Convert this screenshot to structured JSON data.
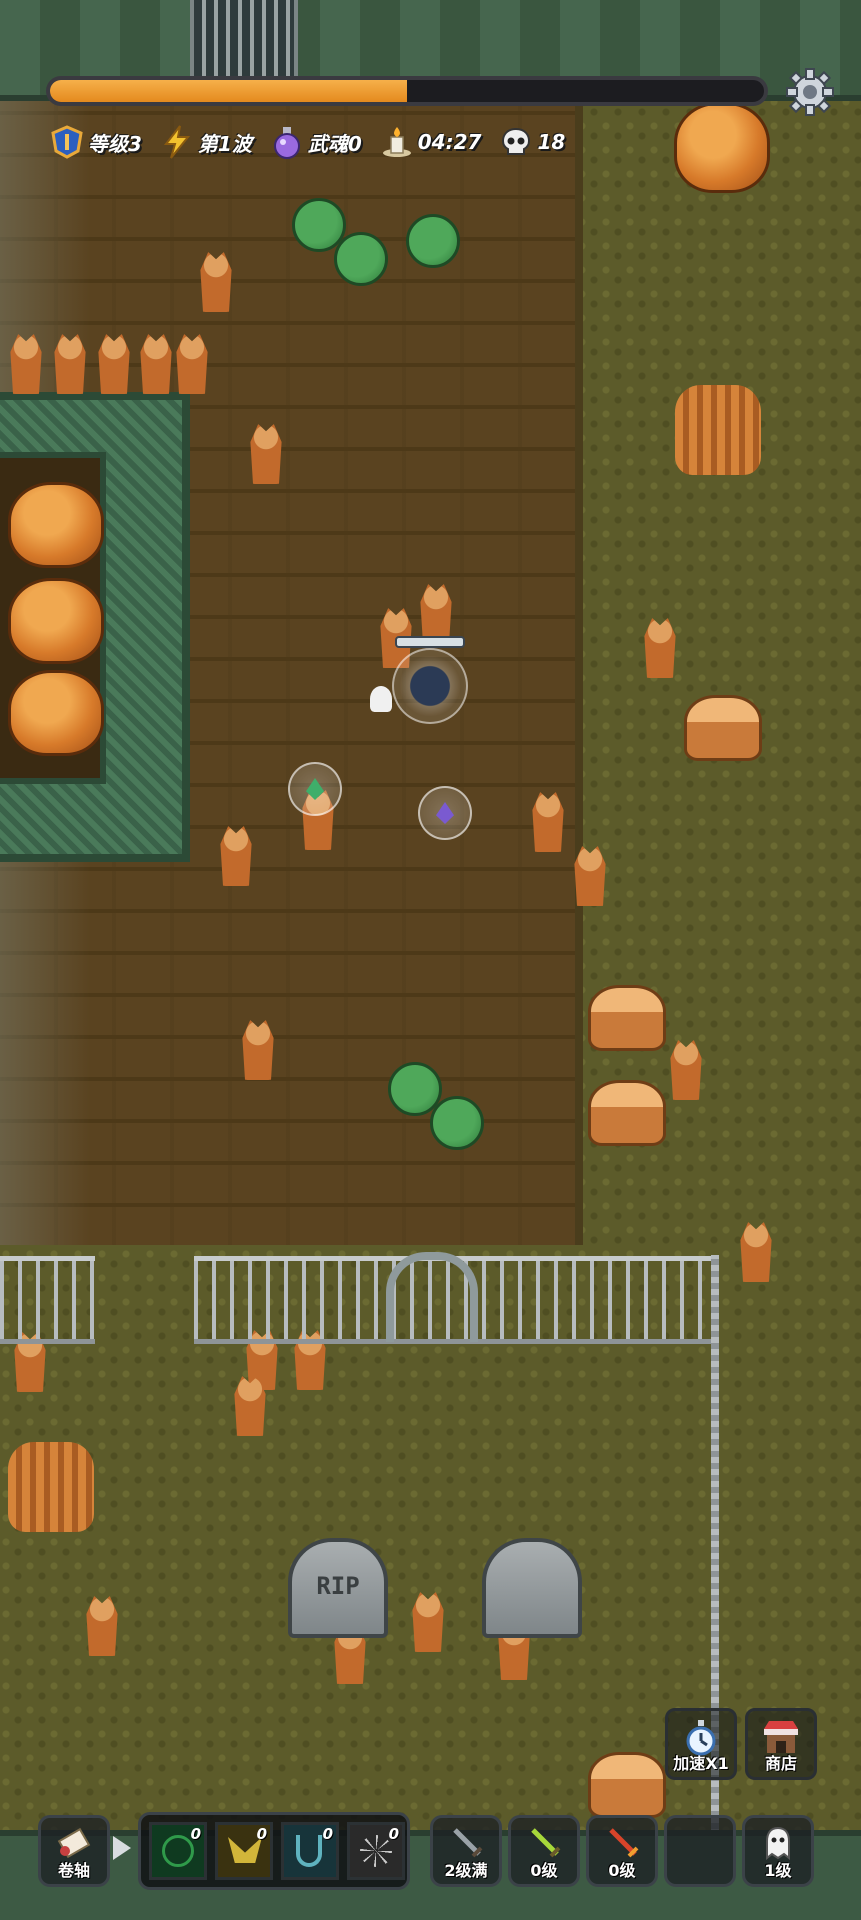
{
  "hud": {
    "progress": 0.5,
    "stats": [
      {
        "icon": "level-badge-icon",
        "label": "等级3"
      },
      {
        "icon": "lightning-icon",
        "label": "第1波"
      },
      {
        "icon": "potion-icon",
        "label": "武魂0"
      },
      {
        "icon": "candle-timer-icon",
        "label": "04:27"
      },
      {
        "icon": "skull-icon",
        "label": "18"
      }
    ]
  },
  "side_buttons": {
    "speed": {
      "label": "加速X1",
      "icon": "stopwatch-icon"
    },
    "shop": {
      "label": "商店",
      "icon": "shop-icon"
    }
  },
  "bottom_bar": {
    "scroll": {
      "label": "卷轴",
      "icon": "scroll-icon"
    },
    "skills": [
      {
        "icon": "dragon-skill-icon",
        "count": "0",
        "color": "#2f9a4a"
      },
      {
        "icon": "wings-skill-icon",
        "count": "0",
        "color": "#d2b63a"
      },
      {
        "icon": "lyre-skill-icon",
        "count": "0",
        "color": "#5fb3bf"
      },
      {
        "icon": "web-skill-icon",
        "count": "0",
        "color": "#c9c9c9"
      }
    ],
    "weapons": [
      {
        "icon": "gray-sword-icon",
        "label": "2级满"
      },
      {
        "icon": "green-sword-icon",
        "label": "0级"
      },
      {
        "icon": "red-sword-icon",
        "label": "0级"
      },
      {
        "icon": "empty-slot",
        "label": ""
      },
      {
        "icon": "ghost-icon",
        "label": "1级"
      }
    ]
  },
  "scene": {
    "tombstone_text": "RIP"
  }
}
